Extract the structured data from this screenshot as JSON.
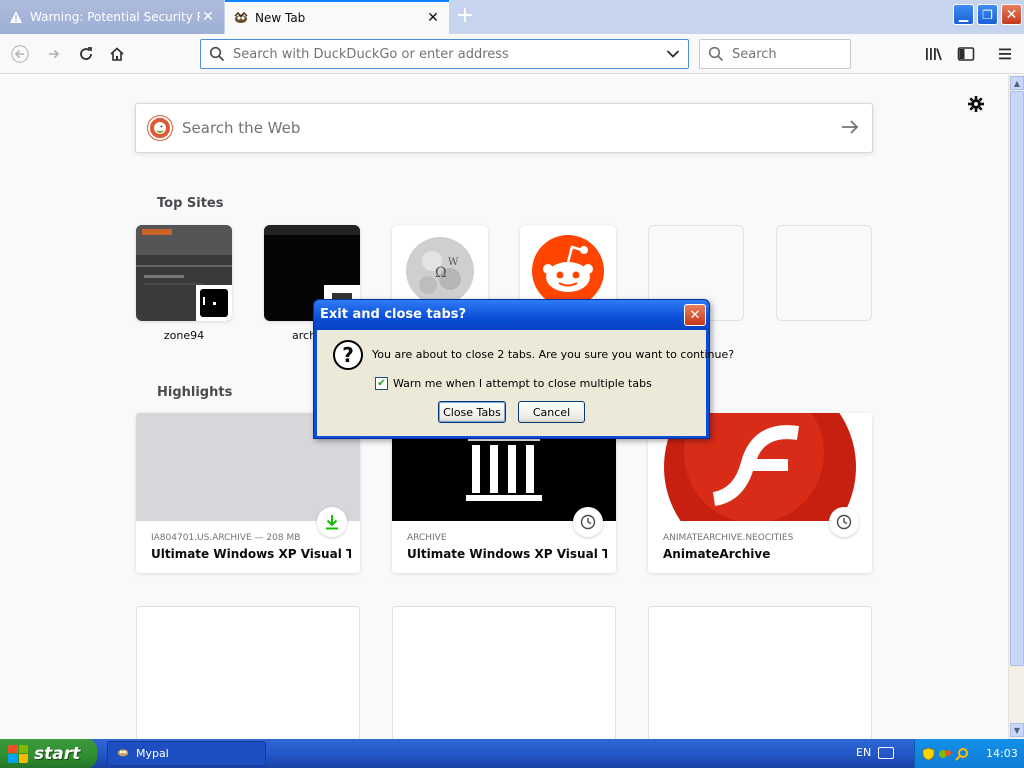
{
  "tabs": [
    {
      "label": "Warning: Potential Security Risk Ah",
      "active": false,
      "icon": "warning-icon"
    },
    {
      "label": "New Tab",
      "active": true,
      "icon": "mypal-icon"
    }
  ],
  "window_controls": {
    "minimize": "minimize-icon",
    "maximize": "restore-icon",
    "close": "close-icon"
  },
  "toolbar": {
    "url_placeholder": "Search with DuckDuckGo or enter address",
    "search_placeholder": "Search"
  },
  "newtab": {
    "search_placeholder": "Search the Web",
    "top_sites_title": "Top Sites",
    "highlights_title": "Highlights",
    "top_sites": [
      {
        "title": "zone94",
        "thumb": "dark-gif"
      },
      {
        "title": "archive",
        "thumb": "black"
      },
      {
        "title": "",
        "thumb": "wikipedia"
      },
      {
        "title": "",
        "thumb": "reddit"
      },
      {
        "title": "",
        "thumb": "empty"
      },
      {
        "title": "",
        "thumb": "empty"
      }
    ],
    "highlights": [
      {
        "source": "IA804701.US.ARCHIVE — 208 MB",
        "title": "Ultimate Windows XP Visual The...",
        "badge": "download-icon",
        "image": "gray"
      },
      {
        "source": "ARCHIVE",
        "title": "Ultimate Windows XP Visual The...",
        "badge": "clock-icon",
        "image": "archive-logo"
      },
      {
        "source": "ANIMATEARCHIVE.NEOCITIES",
        "title": "AnimateArchive",
        "badge": "clock-icon",
        "image": "flash-logo"
      }
    ]
  },
  "dialog": {
    "title": "Exit and close tabs?",
    "message": "You are about to close 2 tabs. Are you sure you want to continue?",
    "checkbox_label": "Warn me when I attempt to close multiple tabs",
    "checkbox_checked": true,
    "primary_button": "Close Tabs",
    "cancel_button": "Cancel"
  },
  "taskbar": {
    "start_label": "start",
    "task_label": "Mypal",
    "language": "EN",
    "clock": "14:03"
  },
  "colors": {
    "accent": "#0a84ff",
    "xp_blue": "#2457c8",
    "start_green": "#2f8f2f",
    "reddit": "#ff4500",
    "flash_red": "#c82010"
  }
}
